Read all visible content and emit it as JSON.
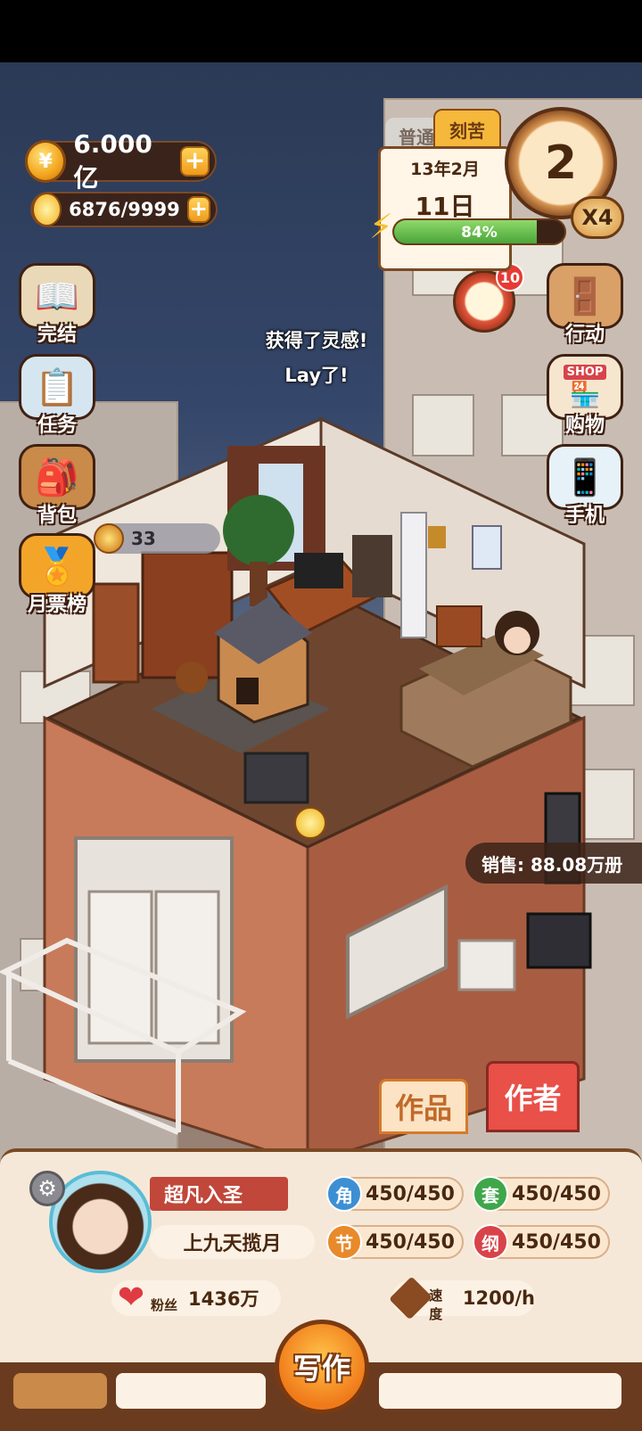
{
  "resources": {
    "coins": "6.000亿",
    "inspiration": "6876/9999"
  },
  "menu_left": [
    {
      "label": "完结"
    },
    {
      "label": "任务"
    },
    {
      "label": "背包"
    },
    {
      "label": "月票榜"
    }
  ],
  "menu_right": [
    {
      "label": "行动"
    },
    {
      "label": "购物"
    },
    {
      "label": "手机"
    }
  ],
  "calendar": {
    "mode_normal": "普通",
    "mode_hard": "刻苦",
    "month": "13年2月",
    "day": "11日",
    "energy_percent": "84%",
    "energy_value": 0.84,
    "clock_number": "2",
    "multiplier": "X4"
  },
  "event_badge": "10",
  "float_messages": [
    "获得了灵感!",
    "Lay了!"
  ],
  "shop_sign": "SHOP",
  "room_coin_count": "33",
  "sales": "销售: 88.08万册",
  "tabs": {
    "works": "作品",
    "author": "作者"
  },
  "author": {
    "rank": "超凡入圣",
    "name": "上九天揽月",
    "fans_label": "粉丝",
    "fans": "1436万",
    "speed_label": "速度",
    "speed": "1200/h",
    "stats": [
      {
        "badge": "角",
        "value": "450/450",
        "color": "#3d8fd4"
      },
      {
        "badge": "套",
        "value": "450/450",
        "color": "#3fa64a"
      },
      {
        "badge": "节",
        "value": "450/450",
        "color": "#e88a2a"
      },
      {
        "badge": "纲",
        "value": "450/450",
        "color": "#d8434a"
      }
    ]
  },
  "write_button": "写作"
}
